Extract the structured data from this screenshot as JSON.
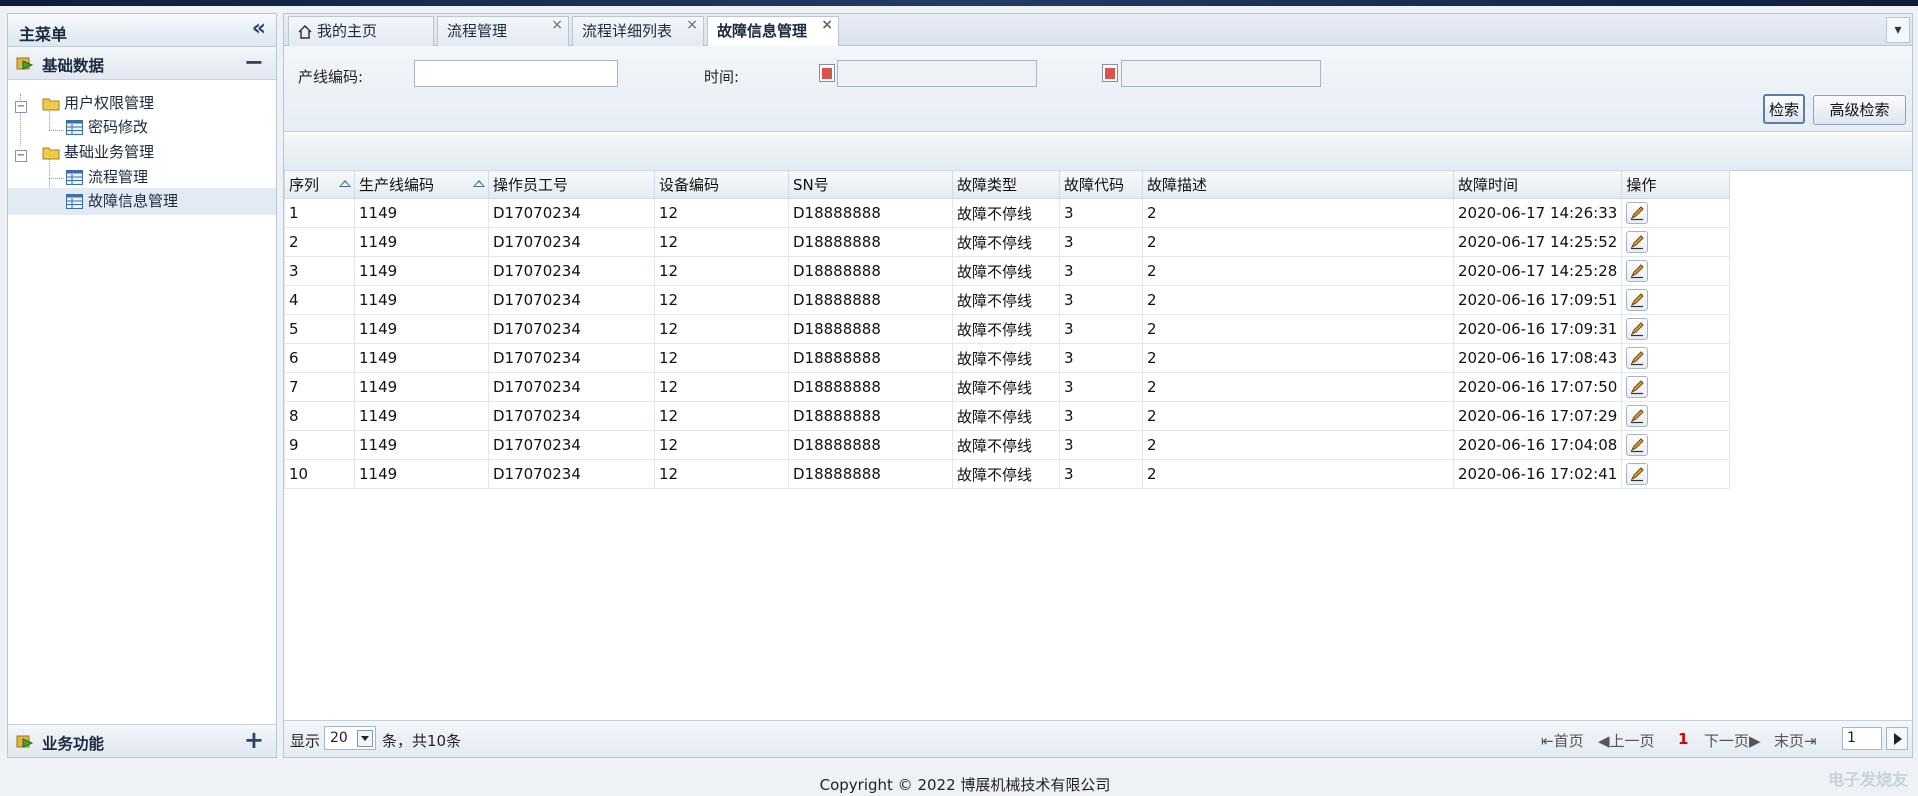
{
  "sidebar": {
    "title": "主菜单",
    "groups": [
      {
        "label": "基础数据",
        "expanded": true,
        "nodes": [
          {
            "label": "用户权限管理",
            "children": [
              {
                "label": "密码修改"
              }
            ]
          },
          {
            "label": "基础业务管理",
            "children": [
              {
                "label": "流程管理"
              },
              {
                "label": "故障信息管理",
                "selected": true
              }
            ]
          }
        ]
      },
      {
        "label": "业务功能",
        "expanded": false
      }
    ]
  },
  "tabs": [
    {
      "label": "我的主页",
      "closable": false
    },
    {
      "label": "流程管理",
      "closable": true
    },
    {
      "label": "流程详细列表",
      "closable": true
    },
    {
      "label": "故障信息管理",
      "closable": true,
      "active": true
    }
  ],
  "search": {
    "line_code_label": "产线编码:",
    "line_code_value": "",
    "time_label": "时间:",
    "time_from": "",
    "time_to": "",
    "search_button": "检索",
    "advanced_button": "高级检索"
  },
  "table": {
    "columns": [
      "序列",
      "生产线编码",
      "操作员工号",
      "设备编码",
      "SN号",
      "故障类型",
      "故障代码",
      "故障描述",
      "故障时间",
      "操作"
    ],
    "rows": [
      [
        "1",
        "1149",
        "D17070234",
        "12",
        "D18888888",
        "故障不停线",
        "3",
        "2",
        "2020-06-17 14:26:33"
      ],
      [
        "2",
        "1149",
        "D17070234",
        "12",
        "D18888888",
        "故障不停线",
        "3",
        "2",
        "2020-06-17 14:25:52"
      ],
      [
        "3",
        "1149",
        "D17070234",
        "12",
        "D18888888",
        "故障不停线",
        "3",
        "2",
        "2020-06-17 14:25:28"
      ],
      [
        "4",
        "1149",
        "D17070234",
        "12",
        "D18888888",
        "故障不停线",
        "3",
        "2",
        "2020-06-16 17:09:51"
      ],
      [
        "5",
        "1149",
        "D17070234",
        "12",
        "D18888888",
        "故障不停线",
        "3",
        "2",
        "2020-06-16 17:09:31"
      ],
      [
        "6",
        "1149",
        "D17070234",
        "12",
        "D18888888",
        "故障不停线",
        "3",
        "2",
        "2020-06-16 17:08:43"
      ],
      [
        "7",
        "1149",
        "D17070234",
        "12",
        "D18888888",
        "故障不停线",
        "3",
        "2",
        "2020-06-16 17:07:50"
      ],
      [
        "8",
        "1149",
        "D17070234",
        "12",
        "D18888888",
        "故障不停线",
        "3",
        "2",
        "2020-06-16 17:07:29"
      ],
      [
        "9",
        "1149",
        "D17070234",
        "12",
        "D18888888",
        "故障不停线",
        "3",
        "2",
        "2020-06-16 17:04:08"
      ],
      [
        "10",
        "1149",
        "D17070234",
        "12",
        "D18888888",
        "故障不停线",
        "3",
        "2",
        "2020-06-16 17:02:41"
      ]
    ]
  },
  "pager": {
    "show_label": "显示",
    "page_size": "20",
    "summary": "条，共10条",
    "first": "首页",
    "prev": "上一页",
    "current": "1",
    "next": "下一页",
    "last": "末页",
    "page_input": "1"
  },
  "footer": {
    "copyright": "Copyright © 2022 博展机械技术有限公司"
  },
  "watermark": "电子发烧友",
  "colors": {
    "accent": "#3a6ea5",
    "current_page": "#dd0000",
    "header_bg": "#e4eaf1"
  }
}
